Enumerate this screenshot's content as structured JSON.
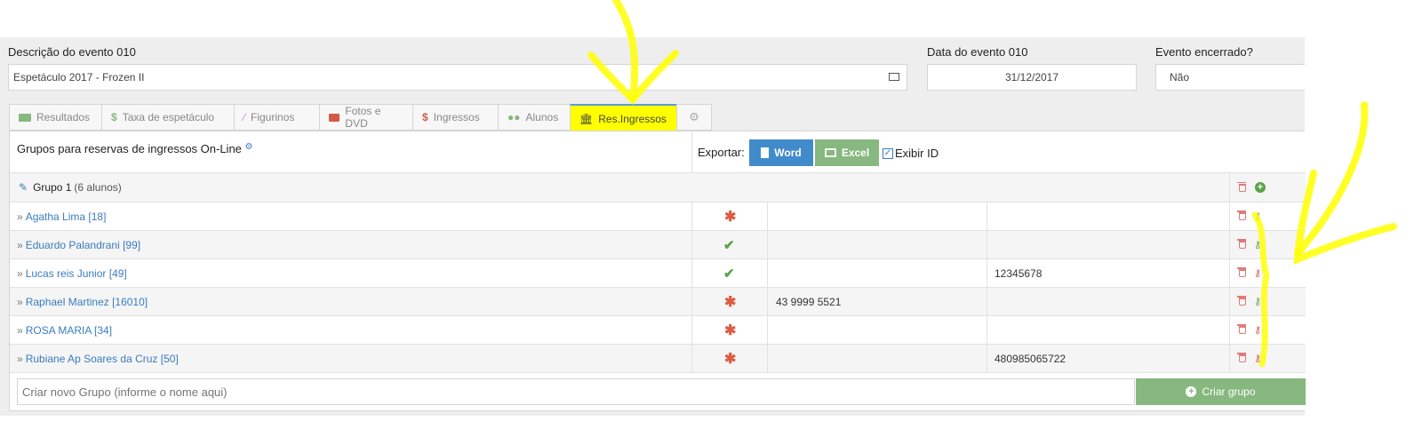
{
  "event": {
    "desc_label": "Descrição do evento 010",
    "desc_value": "Espetáculo 2017 - Frozen II",
    "date_label": "Data do evento 010",
    "date_value": "31/12/2017",
    "closed_label": "Evento encerrado?",
    "closed_value": "Não"
  },
  "tabs": [
    {
      "label": "Resultados",
      "icon": "money-icon"
    },
    {
      "label": "Taxa de espetáculo",
      "icon": "dollar-icon"
    },
    {
      "label": "Figurinos",
      "icon": "magic-wand-icon"
    },
    {
      "label": "Fotos e DVD",
      "icon": "video-camera-icon"
    },
    {
      "label": "Ingressos",
      "icon": "dollar-icon"
    },
    {
      "label": "Alunos",
      "icon": "users-icon"
    },
    {
      "label": "Res.Ingressos",
      "icon": "bank-icon",
      "active": true
    },
    {
      "label": "",
      "icon": "gears-icon"
    }
  ],
  "section": {
    "title": "Grupos para reservas de ingressos On-Line",
    "export_label": "Exportar:",
    "word_label": "Word",
    "excel_label": "Excel",
    "show_id_label": "Exibir ID"
  },
  "group": {
    "name": "Grupo 1",
    "count": "(6 alunos)"
  },
  "students": [
    {
      "name": "Agatha Lima [18]",
      "status": "pending",
      "phone": "",
      "code": "",
      "key_color": "green"
    },
    {
      "name": "Eduardo Palandrani [99]",
      "status": "ok",
      "phone": "",
      "code": "",
      "key_color": "green"
    },
    {
      "name": "Lucas reis Junior [49]",
      "status": "ok",
      "phone": "",
      "code": "12345678",
      "key_color": "red"
    },
    {
      "name": "Raphael Martinez [16010]",
      "status": "pending",
      "phone": "43 9999 5521",
      "code": "",
      "key_color": "green"
    },
    {
      "name": "ROSA MARIA [34]",
      "status": "pending",
      "phone": "",
      "code": "",
      "key_color": "red"
    },
    {
      "name": "Rubiane Ap Soares da Cruz [50]",
      "status": "pending",
      "phone": "",
      "code": "480985065722",
      "key_color": "red"
    }
  ],
  "new_group": {
    "placeholder": "Criar novo Grupo (informe o nome aqui)",
    "button_label": "Criar grupo"
  },
  "colors": {
    "link": "#3a7cbf",
    "word_button": "#428bca",
    "excel_button": "#87b87f",
    "pending": "#dd5a43",
    "ok": "#5aa34a",
    "highlight": "#ffff00"
  }
}
